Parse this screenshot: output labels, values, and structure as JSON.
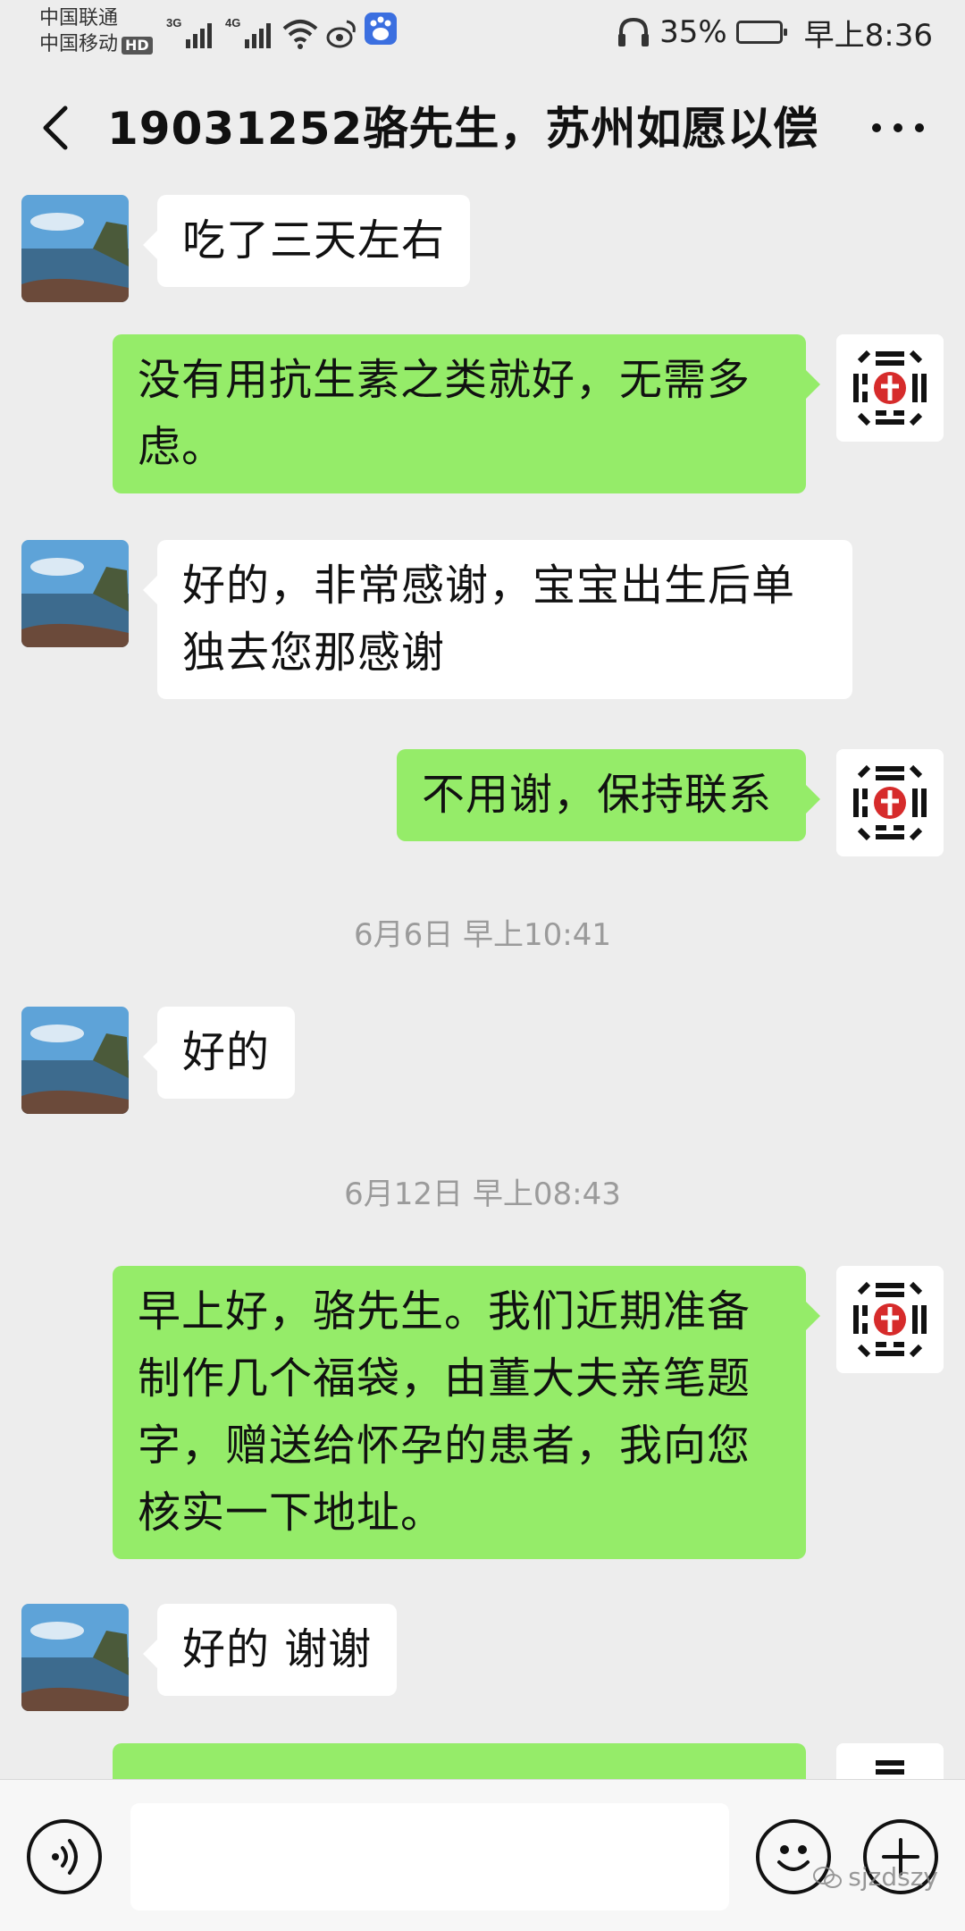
{
  "status_bar": {
    "carrier1": "中国联通",
    "carrier2": "中国移动",
    "hd": "HD",
    "net1": "3G",
    "net2": "4G",
    "battery": "35%",
    "time": "早上8:36"
  },
  "header": {
    "title": "19031252骆先生，苏州如愿以偿"
  },
  "messages": [
    {
      "side": "in",
      "text_lines": [
        "吃了三天左右"
      ]
    },
    {
      "side": "out",
      "text_lines": [
        "没有用抗生素之类就好，无需多",
        "虑。"
      ]
    },
    {
      "side": "in",
      "text_lines": [
        "好的，非常感谢，宝宝出生后单",
        "独去您那感谢"
      ]
    },
    {
      "side": "out",
      "text_lines": [
        "不用谢，保持联系"
      ]
    },
    {
      "type": "timestamp",
      "text": "6月6日 早上10:41"
    },
    {
      "side": "in",
      "text_lines": [
        "好的"
      ]
    },
    {
      "type": "timestamp",
      "text": "6月12日 早上08:43"
    },
    {
      "side": "out",
      "text_lines": [
        "早上好，骆先生。我们近期准备",
        "制作几个福袋，由董大夫亲笔题",
        "字，赠送给怀孕的患者，我向您",
        "核实一下地址。"
      ]
    },
    {
      "side": "in",
      "text_lines": [
        "好的 谢谢"
      ]
    }
  ],
  "watermark": "sjzdszy",
  "colors": {
    "background": "#ededed",
    "incoming_bubble": "#ffffff",
    "outgoing_bubble": "#95ec69",
    "timestamp": "#9b9b9b"
  }
}
